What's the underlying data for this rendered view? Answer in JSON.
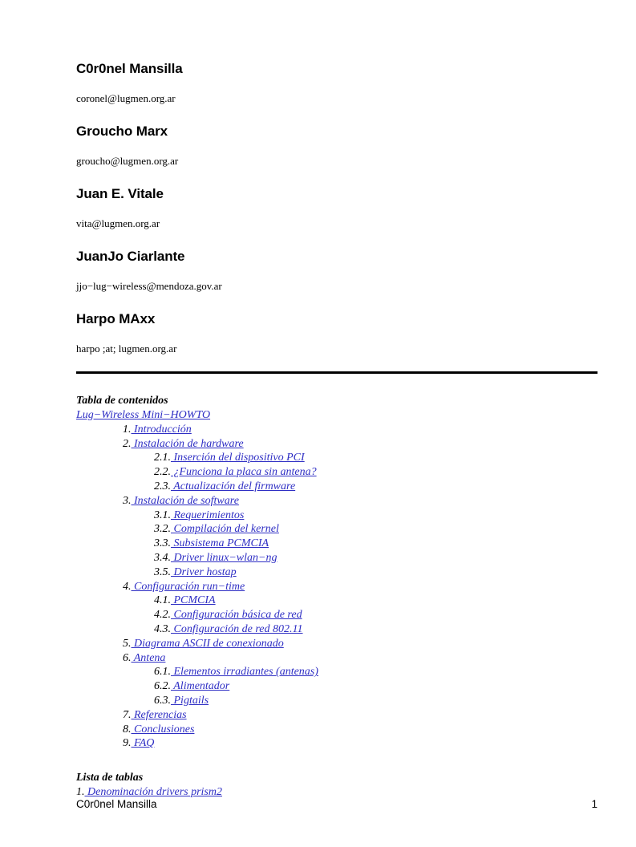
{
  "colors": {
    "link": "#2e2ec4",
    "text": "#000000",
    "rule": "#000000",
    "background": "#ffffff"
  },
  "authors": [
    {
      "name": "C0r0nel Mansilla",
      "email": "coronel@lugmen.org.ar"
    },
    {
      "name": "Groucho Marx",
      "email": "groucho@lugmen.org.ar"
    },
    {
      "name": "Juan E. Vitale",
      "email": "vita@lugmen.org.ar"
    },
    {
      "name": "JuanJo Ciarlante",
      "email": "jjo−lug−wireless@mendoza.gov.ar"
    },
    {
      "name": "Harpo MAxx",
      "email": "harpo ;at; lugmen.org.ar"
    }
  ],
  "toc": {
    "title": "Tabla de contenidos",
    "root_label": "Lug−Wireless Mini−HOWTO",
    "entries": [
      {
        "number": "1.",
        "label": " Introducción",
        "level": 1
      },
      {
        "number": "2.",
        "label": " Instalación de hardware",
        "level": 1
      },
      {
        "number": "2.1.",
        "label": " Inserción del dispositivo PCI",
        "level": 2
      },
      {
        "number": "2.2.",
        "label": " ¿Funciona la placa sin antena?",
        "level": 2
      },
      {
        "number": "2.3.",
        "label": " Actualización del firmware",
        "level": 2
      },
      {
        "number": "3.",
        "label": " Instalación de software",
        "level": 1
      },
      {
        "number": "3.1.",
        "label": " Requerimientos",
        "level": 2
      },
      {
        "number": "3.2.",
        "label": " Compilación del kernel",
        "level": 2
      },
      {
        "number": "3.3.",
        "label": " Subsistema PCMCIA",
        "level": 2
      },
      {
        "number": "3.4.",
        "label": " Driver linux−wlan−ng",
        "level": 2
      },
      {
        "number": "3.5.",
        "label": " Driver hostap",
        "level": 2
      },
      {
        "number": "4.",
        "label": " Configuración run−time",
        "level": 1
      },
      {
        "number": "4.1.",
        "label": " PCMCIA",
        "level": 2
      },
      {
        "number": "4.2.",
        "label": " Configuración básica de red",
        "level": 2
      },
      {
        "number": "4.3.",
        "label": " Configuración de red 802.11",
        "level": 2
      },
      {
        "number": "5.",
        "label": " Diagrama ASCII de conexionado",
        "level": 1
      },
      {
        "number": "6.",
        "label": " Antena",
        "level": 1
      },
      {
        "number": "6.1.",
        "label": " Elementos irradiantes (antenas)",
        "level": 2
      },
      {
        "number": "6.2.",
        "label": " Alimentador",
        "level": 2
      },
      {
        "number": "6.3.",
        "label": " Pigtails",
        "level": 2
      },
      {
        "number": "7.",
        "label": " Referencias",
        "level": 1
      },
      {
        "number": "8.",
        "label": " Conclusiones",
        "level": 1
      },
      {
        "number": "9.",
        "label": " FAQ",
        "level": 1
      }
    ]
  },
  "list_of_tables": {
    "title": "Lista de tablas",
    "entries": [
      {
        "number": "1.",
        "label": " Denominación drivers prism2",
        "level": 0
      }
    ]
  },
  "footer": {
    "left": "C0r0nel Mansilla",
    "page_number": "1"
  }
}
